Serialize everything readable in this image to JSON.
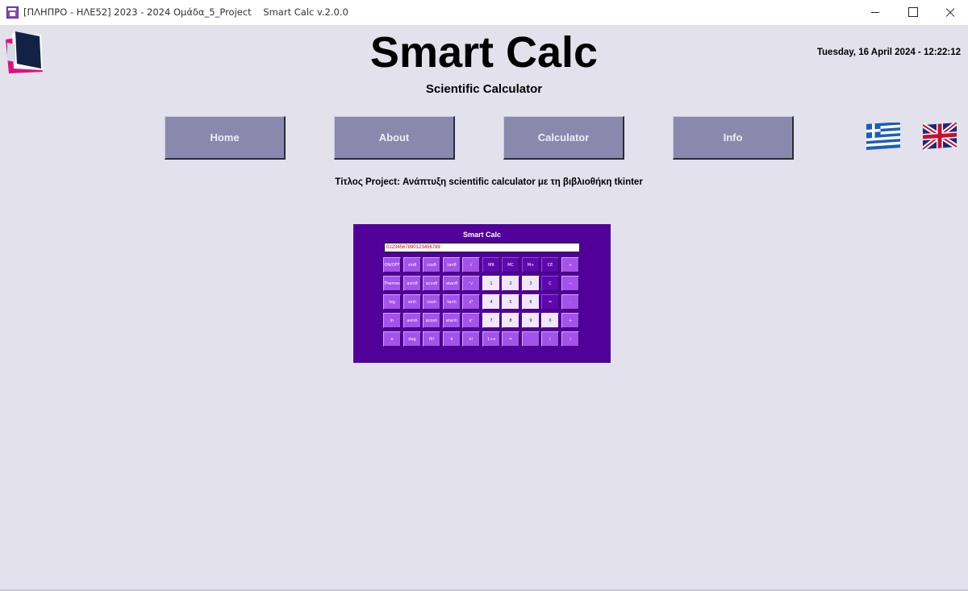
{
  "window": {
    "title": "[ΠΛΗΠΡΟ - ΗΛΕ52] 2023 - 2024 Ομάδα_5_Project    Smart Calc v.2.0.0"
  },
  "header": {
    "app_title": "Smart Calc",
    "subtitle": "Scientific Calculator",
    "datetime": "Tuesday, 16 April 2024 - 12:22:12"
  },
  "nav": {
    "home": "Home",
    "about": "About",
    "calculator": "Calculator",
    "info": "Info"
  },
  "flags": [
    "greek-flag-icon",
    "uk-flag-icon"
  ],
  "project_title": "Τίτλος Project: Ανάπτυξη scientific calculator με τη βιβλιοθήκη tkinter",
  "calculator": {
    "title": "Smart Calc",
    "display": "01234567890123456789",
    "colors": {
      "panel": "#51009a",
      "function_key": "#a352ea",
      "number_key": "#f2e6fd",
      "memory_key": "#5f08ad"
    },
    "rows": [
      [
        {
          "label": "ON/OFF",
          "kind": "fn"
        },
        {
          "label": "sinθ",
          "kind": "fn"
        },
        {
          "label": "cosθ",
          "kind": "fn"
        },
        {
          "label": "tanθ",
          "kind": "fn"
        },
        {
          "label": "√",
          "kind": "fn"
        },
        {
          "label": "MR",
          "kind": "dark"
        },
        {
          "label": "MC",
          "kind": "dark"
        },
        {
          "label": "M+",
          "kind": "dark"
        },
        {
          "label": "CE",
          "kind": "dark"
        },
        {
          "label": "+",
          "kind": "fn"
        }
      ],
      [
        {
          "label": "Themes",
          "kind": "fn"
        },
        {
          "label": "asinθ",
          "kind": "fn"
        },
        {
          "label": "acosθ",
          "kind": "fn"
        },
        {
          "label": "atanθ",
          "kind": "fn"
        },
        {
          "label": "ⁿ√",
          "kind": "fn"
        },
        {
          "label": "1",
          "kind": "num"
        },
        {
          "label": "2",
          "kind": "num"
        },
        {
          "label": "3",
          "kind": "num"
        },
        {
          "label": "C",
          "kind": "dark"
        },
        {
          "label": "−",
          "kind": "fn"
        }
      ],
      [
        {
          "label": "log",
          "kind": "fn"
        },
        {
          "label": "sinh",
          "kind": "fn"
        },
        {
          "label": "cosh",
          "kind": "fn"
        },
        {
          "label": "tanh",
          "kind": "fn"
        },
        {
          "label": "x²",
          "kind": "fn"
        },
        {
          "label": "4",
          "kind": "num"
        },
        {
          "label": "5",
          "kind": "num"
        },
        {
          "label": "6",
          "kind": "num"
        },
        {
          "label": "=",
          "kind": "dark"
        },
        {
          "label": "·",
          "kind": "fn"
        }
      ],
      [
        {
          "label": "ln",
          "kind": "fn"
        },
        {
          "label": "asinh",
          "kind": "fn"
        },
        {
          "label": "acosh",
          "kind": "fn"
        },
        {
          "label": "atanh",
          "kind": "fn"
        },
        {
          "label": "xⁿ",
          "kind": "fn"
        },
        {
          "label": "7",
          "kind": "num"
        },
        {
          "label": "8",
          "kind": "num"
        },
        {
          "label": "9",
          "kind": "num"
        },
        {
          "label": "0",
          "kind": "num"
        },
        {
          "label": "+",
          "kind": "fn"
        }
      ],
      [
        {
          "label": "e",
          "kind": "fn"
        },
        {
          "label": "deg",
          "kind": "fn"
        },
        {
          "label": "fill",
          "kind": "fn"
        },
        {
          "label": "π",
          "kind": "fn"
        },
        {
          "label": "n!",
          "kind": "fn"
        },
        {
          "label": "1+x",
          "kind": "fn"
        },
        {
          "label": "=",
          "kind": "fn"
        },
        {
          "label": "",
          "kind": "blank"
        },
        {
          "label": "(",
          "kind": "fn"
        },
        {
          "label": ")",
          "kind": "fn"
        }
      ]
    ]
  }
}
